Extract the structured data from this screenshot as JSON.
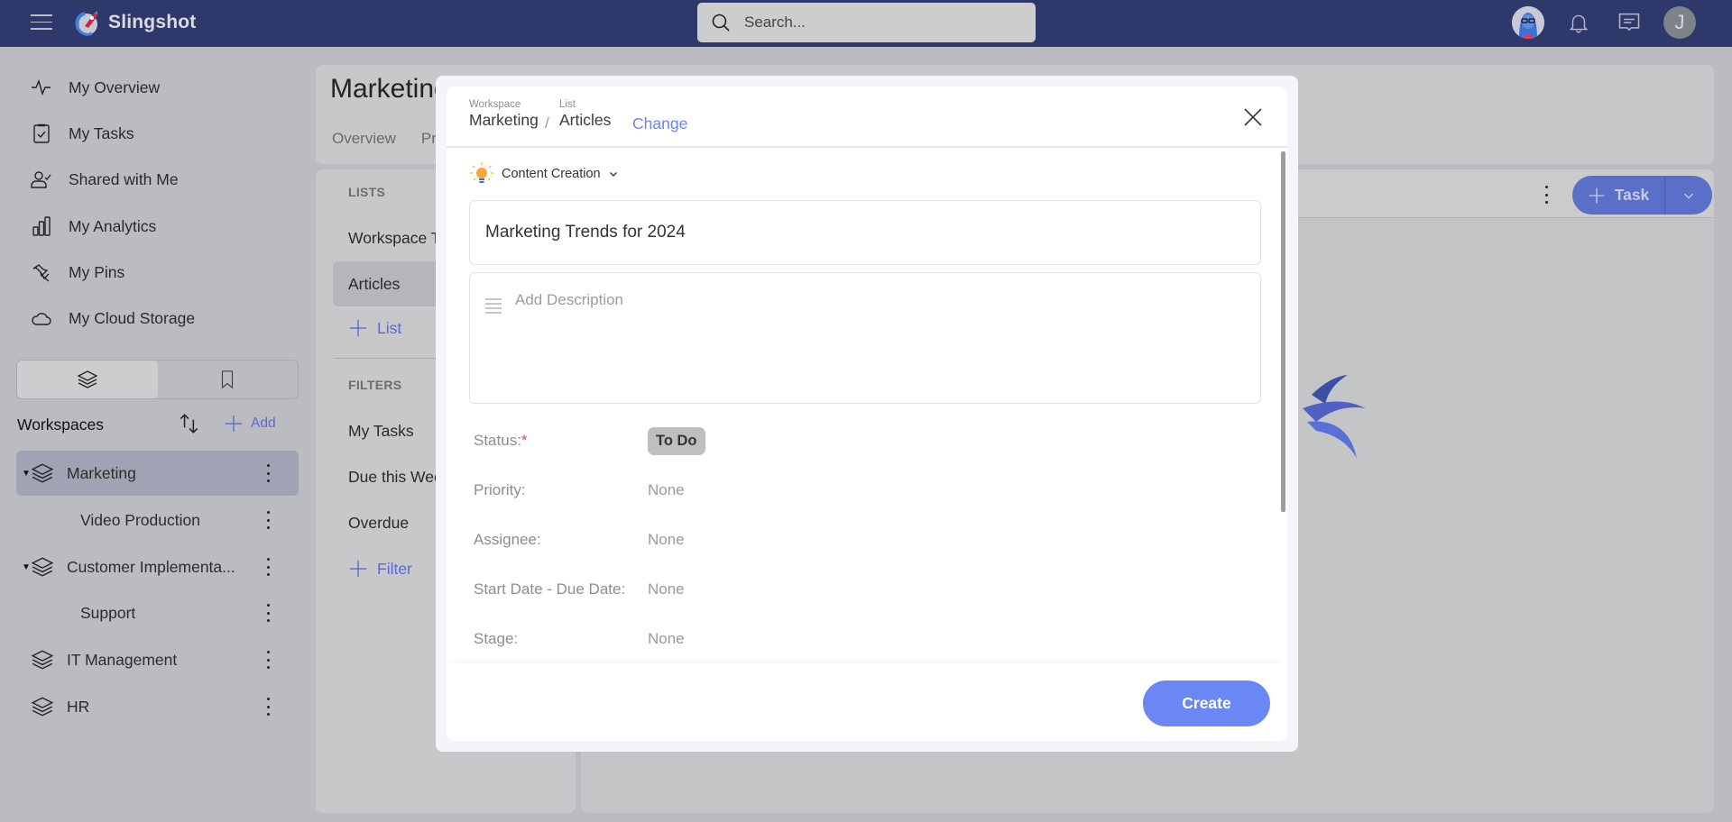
{
  "app": {
    "name": "Slingshot",
    "search": {
      "placeholder": "Search...",
      "value": ""
    },
    "user_initial": "J"
  },
  "sidebar": {
    "nav": [
      {
        "label": "My Overview",
        "icon": "pulse-icon"
      },
      {
        "label": "My Tasks",
        "icon": "clipboard-check-icon"
      },
      {
        "label": "Shared with Me",
        "icon": "user-check-icon"
      },
      {
        "label": "My Analytics",
        "icon": "bar-chart-icon"
      },
      {
        "label": "My Pins",
        "icon": "pin-icon"
      },
      {
        "label": "My Cloud Storage",
        "icon": "cloud-icon"
      }
    ],
    "toggle": [
      {
        "icon": "layers-icon",
        "active": true
      },
      {
        "icon": "bookmark-icon",
        "active": false
      }
    ],
    "workspaces_title": "Workspaces",
    "add_label": "Add",
    "workspaces": [
      {
        "label": "Marketing",
        "level": 0,
        "expanded": true,
        "active": true
      },
      {
        "label": "Video Production",
        "level": 1
      },
      {
        "label": "Customer Implementa...",
        "level": 0,
        "expanded": true
      },
      {
        "label": "Support",
        "level": 1
      },
      {
        "label": "IT Management",
        "level": 0
      },
      {
        "label": "HR",
        "level": 0
      }
    ]
  },
  "page": {
    "title": "Marketing",
    "tabs": [
      "Overview",
      "Pr"
    ]
  },
  "lists_panel": {
    "lists_heading": "LISTS",
    "lists": [
      {
        "label": "Workspace Tasks",
        "active": false
      },
      {
        "label": "Articles",
        "active": true
      }
    ],
    "add_list_label": "List",
    "filters_heading": "FILTERS",
    "filters": [
      "My Tasks",
      "Due this Week",
      "Overdue"
    ],
    "add_filter_label": "Filter"
  },
  "main": {
    "task_button_label": "Task"
  },
  "modal": {
    "workspace_caption": "Workspace",
    "workspace_value": "Marketing",
    "list_caption": "List",
    "list_value": "Articles",
    "separator": "/",
    "change_label": "Change",
    "category": "Content Creation",
    "title_value": "Marketing Trends for 2024",
    "description_placeholder": "Add Description",
    "fields": [
      {
        "label": "Status:",
        "required": true,
        "value": "To Do"
      },
      {
        "label": "Priority:",
        "value": "None"
      },
      {
        "label": "Assignee:",
        "value": "None"
      },
      {
        "label": "Start Date - Due Date:",
        "value": "None"
      },
      {
        "label": "Stage:",
        "value": "None"
      }
    ],
    "required_mark": "*",
    "create_label": "Create"
  },
  "colors": {
    "topbar": "#2f386b",
    "accent": "#6b87f5",
    "link": "#6b85e6",
    "required": "#e24c4c"
  }
}
